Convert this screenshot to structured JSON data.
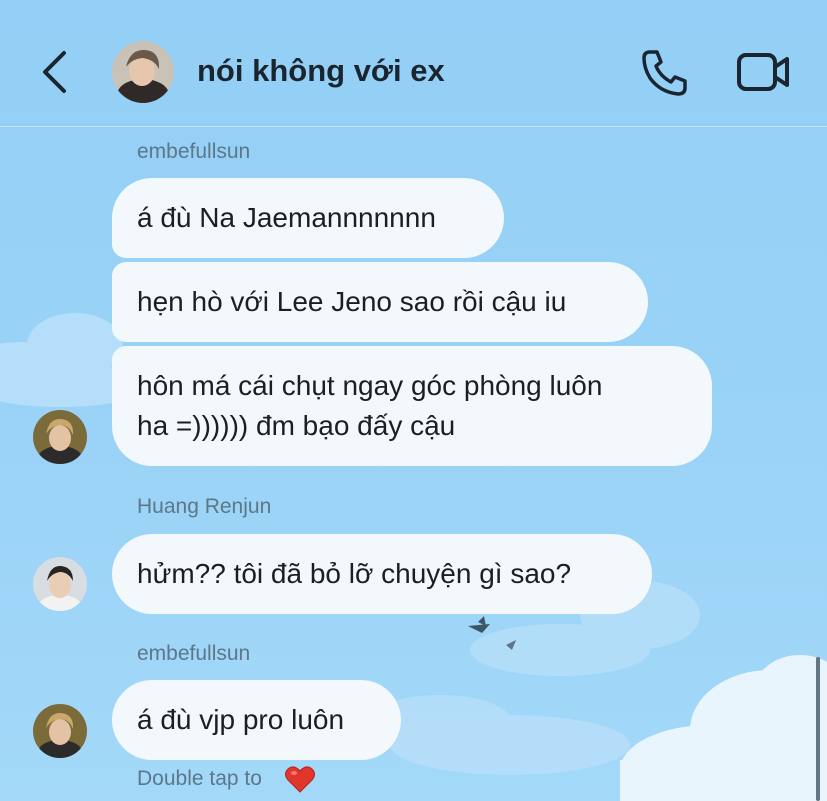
{
  "header": {
    "title": "nói không với ex",
    "back_icon": "chevron-left-icon",
    "call_icon": "phone-icon",
    "video_icon": "video-camera-icon"
  },
  "messages": [
    {
      "sender": "embefullsun",
      "texts": [
        "á đù Na Jaemannnnnnn",
        "hẹn hò với Lee Jeno sao rồi cậu iu",
        "hôn má cái chụt ngay góc phòng luôn",
        "ha =)))))) đm bạo đấy cậu"
      ]
    },
    {
      "sender": "Huang Renjun",
      "texts": [
        "hửm?? tôi đã bỏ lỡ chuyện gì sao?"
      ]
    },
    {
      "sender": "embefullsun",
      "texts": [
        "á đù vjp pro luôn"
      ]
    }
  ],
  "footer": {
    "hint": "Double tap to",
    "heart_icon": "red-heart-icon"
  },
  "colors": {
    "background": "#9ad3f7",
    "bubble": "#f3f8fc",
    "text": "#1b1f24",
    "secondary_text": "#5d7789",
    "heart": "#e0362c"
  }
}
